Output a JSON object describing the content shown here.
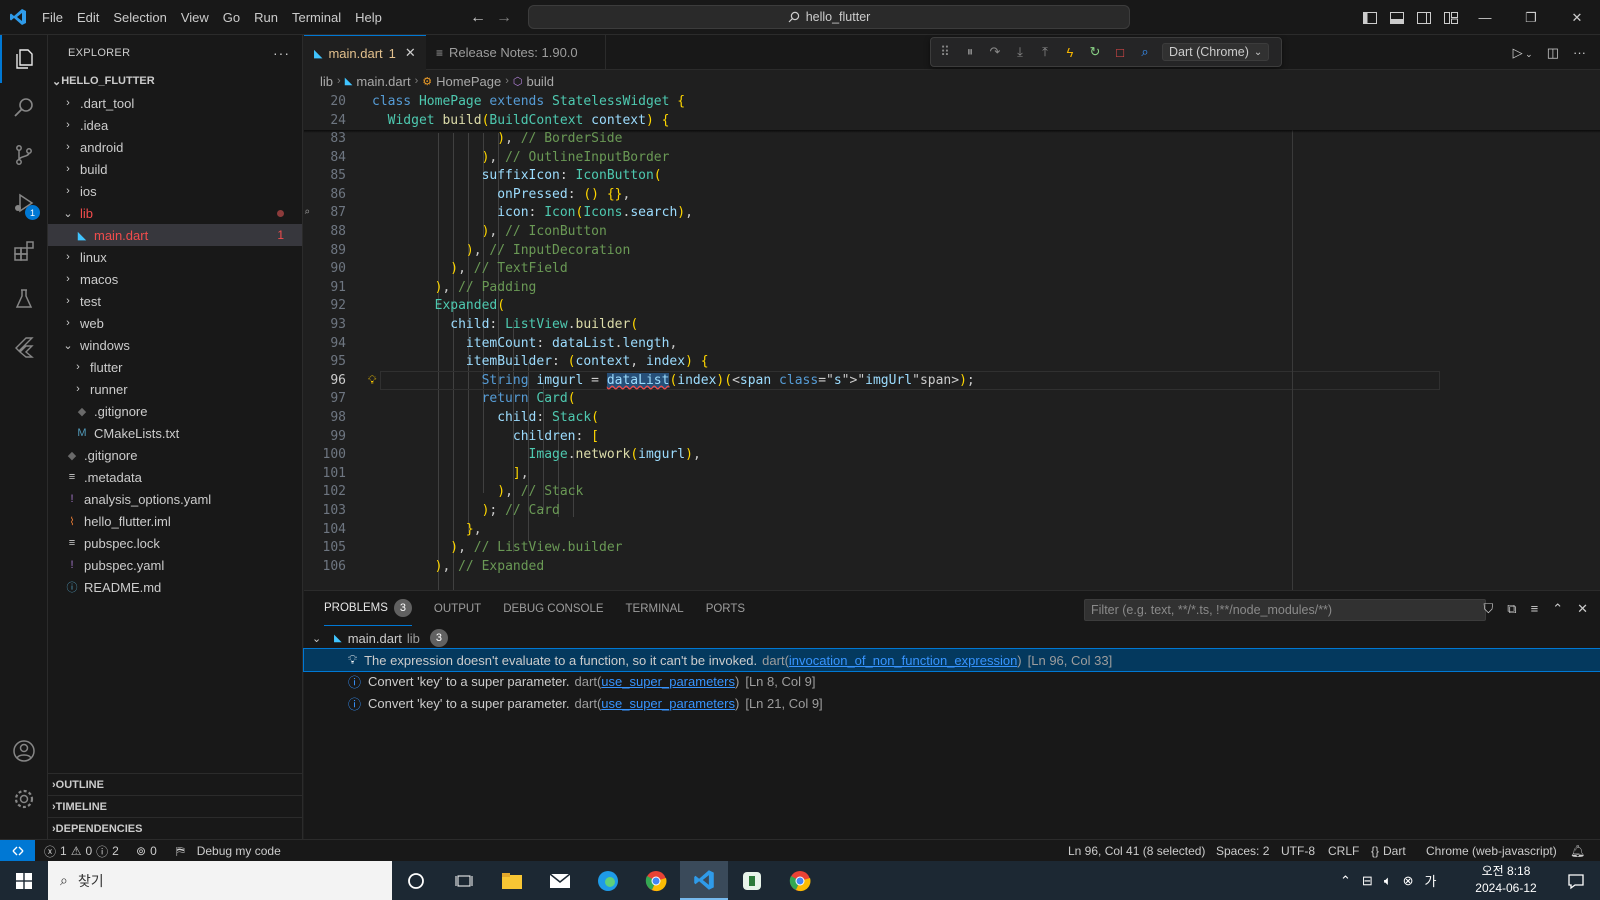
{
  "menu": [
    "File",
    "Edit",
    "Selection",
    "View",
    "Go",
    "Run",
    "Terminal",
    "Help"
  ],
  "command_center": "hello_flutter",
  "explorer": {
    "title": "EXPLORER",
    "project": "HELLO_FLUTTER",
    "items": [
      {
        "label": ".dart_tool",
        "type": "folder",
        "depth": 1
      },
      {
        "label": ".idea",
        "type": "folder",
        "depth": 1
      },
      {
        "label": "android",
        "type": "folder",
        "depth": 1
      },
      {
        "label": "build",
        "type": "folder",
        "depth": 1
      },
      {
        "label": "ios",
        "type": "folder",
        "depth": 1
      },
      {
        "label": "lib",
        "type": "folder-open",
        "depth": 1
      },
      {
        "label": "main.dart",
        "type": "dart",
        "depth": 2,
        "problems": "1"
      },
      {
        "label": "linux",
        "type": "folder",
        "depth": 1
      },
      {
        "label": "macos",
        "type": "folder",
        "depth": 1
      },
      {
        "label": "test",
        "type": "folder",
        "depth": 1
      },
      {
        "label": "web",
        "type": "folder",
        "depth": 1
      },
      {
        "label": "windows",
        "type": "folder-open",
        "depth": 1
      },
      {
        "label": "flutter",
        "type": "folder",
        "depth": 2
      },
      {
        "label": "runner",
        "type": "folder",
        "depth": 2
      },
      {
        "label": ".gitignore",
        "type": "git",
        "depth": 2
      },
      {
        "label": "CMakeLists.txt",
        "type": "cmake",
        "depth": 2
      },
      {
        "label": ".gitignore",
        "type": "git",
        "depth": 1
      },
      {
        "label": ".metadata",
        "type": "lines",
        "depth": 1
      },
      {
        "label": "analysis_options.yaml",
        "type": "yaml",
        "depth": 1
      },
      {
        "label": "hello_flutter.iml",
        "type": "rss",
        "depth": 1
      },
      {
        "label": "pubspec.lock",
        "type": "lines",
        "depth": 1
      },
      {
        "label": "pubspec.yaml",
        "type": "yaml",
        "depth": 1
      },
      {
        "label": "README.md",
        "type": "info",
        "depth": 1
      }
    ],
    "bottom_sections": [
      "OUTLINE",
      "TIMELINE",
      "DEPENDENCIES"
    ]
  },
  "tabs": [
    {
      "label": "main.dart",
      "problems": "1",
      "active": true
    },
    {
      "label": "Release Notes: 1.90.0",
      "active": false
    }
  ],
  "debug_target": "Dart (Chrome)",
  "breadcrumb": [
    "lib",
    "main.dart",
    "HomePage",
    "build"
  ],
  "editor": {
    "sticky_lines": [
      {
        "ln": "20",
        "code": "class HomePage extends StatelessWidget {"
      },
      {
        "ln": "24",
        "code": "  Widget build(BuildContext context) {"
      }
    ],
    "lines": [
      {
        "ln": "83",
        "code": "                ), // BorderSide"
      },
      {
        "ln": "84",
        "code": "              ), // OutlineInputBorder"
      },
      {
        "ln": "85",
        "code": "              suffixIcon: IconButton("
      },
      {
        "ln": "86",
        "code": "                onPressed: () {},"
      },
      {
        "ln": "87",
        "code": "                icon: Icon(Icons.search),"
      },
      {
        "ln": "88",
        "code": "              ), // IconButton"
      },
      {
        "ln": "89",
        "code": "            ), // InputDecoration"
      },
      {
        "ln": "90",
        "code": "          ), // TextField"
      },
      {
        "ln": "91",
        "code": "        ), // Padding"
      },
      {
        "ln": "92",
        "code": "        Expanded("
      },
      {
        "ln": "93",
        "code": "          child: ListView.builder("
      },
      {
        "ln": "94",
        "code": "            itemCount: dataList.length,"
      },
      {
        "ln": "95",
        "code": "            itemBuilder: (context, index) {"
      },
      {
        "ln": "96",
        "code": "              String imgurl = dataList(index)(\"imgUrl\");"
      },
      {
        "ln": "97",
        "code": "              return Card("
      },
      {
        "ln": "98",
        "code": "                child: Stack("
      },
      {
        "ln": "99",
        "code": "                  children: ["
      },
      {
        "ln": "100",
        "code": "                    Image.network(imgurl),"
      },
      {
        "ln": "101",
        "code": "                  ],"
      },
      {
        "ln": "102",
        "code": "                ), // Stack"
      },
      {
        "ln": "103",
        "code": "              ); // Card"
      },
      {
        "ln": "104",
        "code": "            },"
      },
      {
        "ln": "105",
        "code": "          ), // ListView.builder"
      },
      {
        "ln": "106",
        "code": "        ), // Expanded"
      }
    ]
  },
  "panel": {
    "tabs": [
      {
        "label": "PROBLEMS",
        "badge": "3",
        "active": true
      },
      {
        "label": "OUTPUT"
      },
      {
        "label": "DEBUG CONSOLE"
      },
      {
        "label": "TERMINAL"
      },
      {
        "label": "PORTS"
      }
    ],
    "filter_placeholder": "Filter (e.g. text, **/*.ts, !**/node_modules/**)",
    "group": {
      "file": "main.dart",
      "folder": "lib",
      "count": "3"
    },
    "problems": [
      {
        "severity": "error-lightbulb",
        "message": "The expression doesn't evaluate to a function, so it can't be invoked.",
        "source": "dart",
        "code": "invocation_of_non_function_expression",
        "location": "[Ln 96, Col 33]"
      },
      {
        "severity": "info",
        "message": "Convert 'key' to a super parameter.",
        "source": "dart",
        "code": "use_super_parameters",
        "location": "[Ln 8, Col 9]"
      },
      {
        "severity": "info",
        "message": "Convert 'key' to a super parameter.",
        "source": "dart",
        "code": "use_super_parameters",
        "location": "[Ln 21, Col 9]"
      }
    ]
  },
  "statusbar": {
    "errors": "1",
    "warnings": "0",
    "infos": "2",
    "ports": "0",
    "debug": "Debug my code",
    "position": "Ln 96, Col 41 (8 selected)",
    "spaces": "Spaces: 2",
    "encoding": "UTF-8",
    "eol": "CRLF",
    "language": "Dart",
    "device": "Chrome (web-javascript)"
  },
  "taskbar": {
    "search_placeholder": "찾기",
    "time": "오전 8:18",
    "date": "2024-06-12",
    "ime": "가"
  },
  "colors": {
    "accent": "#0078d4",
    "error": "#f14c4c",
    "modified": "#e2c08d"
  }
}
